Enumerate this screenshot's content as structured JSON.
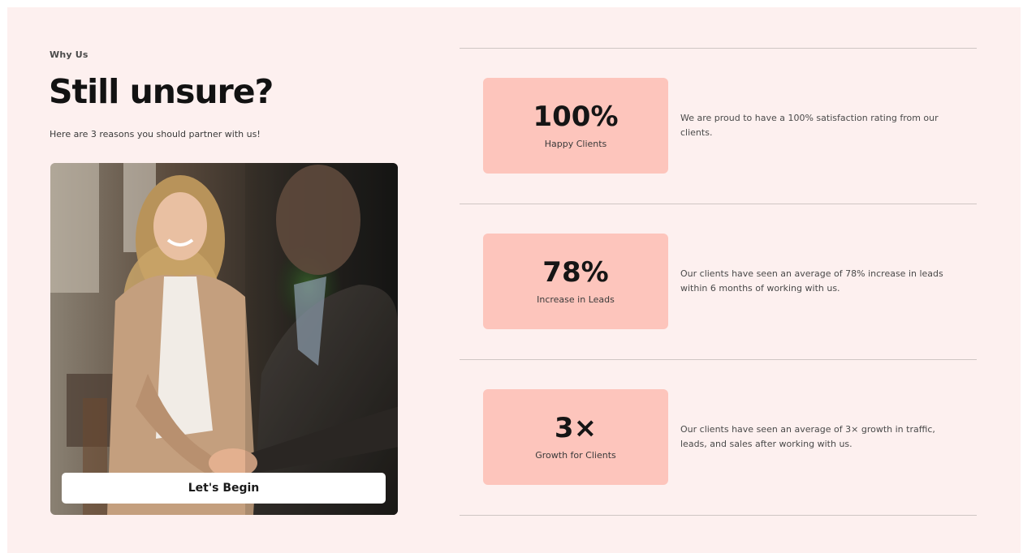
{
  "section": {
    "eyebrow": "Why Us",
    "title": "Still unsure?",
    "subtitle": "Here are 3 reasons you should partner with us!",
    "cta_label": "Let's Begin"
  },
  "stats": [
    {
      "value": "100%",
      "label": "Happy Clients",
      "description": "We are proud to have a 100% satisfaction rating from our clients."
    },
    {
      "value": "78%",
      "label": "Increase in Leads",
      "description": "Our clients have seen an average of 78% increase in leads within 6 months of working with us."
    },
    {
      "value": "3×",
      "label": "Growth for Clients",
      "description": "Our clients have seen an average of 3× growth in traffic, leads, and sales after working with us."
    }
  ],
  "colors": {
    "background": "#fdf0ef",
    "card": "#fdc5bc",
    "rule": "#cfc6c4"
  }
}
